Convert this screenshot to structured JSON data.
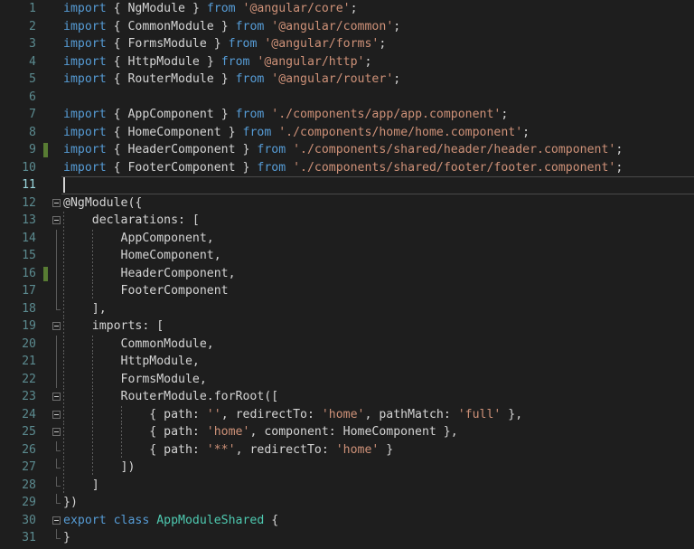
{
  "editor": {
    "language": "typescript",
    "background_color": "#1e1e1e",
    "gutter_number_color": "#5b8a8f",
    "active_gutter_number_color": "#9ad6dd",
    "change_marker_color": "#587c33",
    "colors": {
      "keyword": "#569cd6",
      "string": "#ce9178",
      "class_name": "#4ec9b0",
      "plain": "#d4d4d4"
    },
    "active_line_number": "11",
    "cursor_line": "11",
    "cursor_column": "1"
  },
  "lines": [
    {
      "n": "1",
      "changed": false,
      "fold": "none",
      "indent": 0,
      "tokens": [
        {
          "t": "import ",
          "c": "kw"
        },
        {
          "t": "{ ",
          "c": "pln"
        },
        {
          "t": "NgModule",
          "c": "pln"
        },
        {
          "t": " } ",
          "c": "pln"
        },
        {
          "t": "from ",
          "c": "kw"
        },
        {
          "t": "'@angular/core'",
          "c": "str"
        },
        {
          "t": ";",
          "c": "pln"
        }
      ]
    },
    {
      "n": "2",
      "changed": false,
      "fold": "none",
      "indent": 0,
      "tokens": [
        {
          "t": "import ",
          "c": "kw"
        },
        {
          "t": "{ ",
          "c": "pln"
        },
        {
          "t": "CommonModule",
          "c": "pln"
        },
        {
          "t": " } ",
          "c": "pln"
        },
        {
          "t": "from ",
          "c": "kw"
        },
        {
          "t": "'@angular/common'",
          "c": "str"
        },
        {
          "t": ";",
          "c": "pln"
        }
      ]
    },
    {
      "n": "3",
      "changed": false,
      "fold": "none",
      "indent": 0,
      "tokens": [
        {
          "t": "import ",
          "c": "kw"
        },
        {
          "t": "{ ",
          "c": "pln"
        },
        {
          "t": "FormsModule",
          "c": "pln"
        },
        {
          "t": " } ",
          "c": "pln"
        },
        {
          "t": "from ",
          "c": "kw"
        },
        {
          "t": "'@angular/forms'",
          "c": "str"
        },
        {
          "t": ";",
          "c": "pln"
        }
      ]
    },
    {
      "n": "4",
      "changed": false,
      "fold": "none",
      "indent": 0,
      "tokens": [
        {
          "t": "import ",
          "c": "kw"
        },
        {
          "t": "{ ",
          "c": "pln"
        },
        {
          "t": "HttpModule",
          "c": "pln"
        },
        {
          "t": " } ",
          "c": "pln"
        },
        {
          "t": "from ",
          "c": "kw"
        },
        {
          "t": "'@angular/http'",
          "c": "str"
        },
        {
          "t": ";",
          "c": "pln"
        }
      ]
    },
    {
      "n": "5",
      "changed": false,
      "fold": "none",
      "indent": 0,
      "tokens": [
        {
          "t": "import ",
          "c": "kw"
        },
        {
          "t": "{ ",
          "c": "pln"
        },
        {
          "t": "RouterModule",
          "c": "pln"
        },
        {
          "t": " } ",
          "c": "pln"
        },
        {
          "t": "from ",
          "c": "kw"
        },
        {
          "t": "'@angular/router'",
          "c": "str"
        },
        {
          "t": ";",
          "c": "pln"
        }
      ]
    },
    {
      "n": "6",
      "changed": false,
      "fold": "none",
      "indent": 0,
      "tokens": []
    },
    {
      "n": "7",
      "changed": false,
      "fold": "none",
      "indent": 0,
      "tokens": [
        {
          "t": "import ",
          "c": "kw"
        },
        {
          "t": "{ ",
          "c": "pln"
        },
        {
          "t": "AppComponent",
          "c": "pln"
        },
        {
          "t": " } ",
          "c": "pln"
        },
        {
          "t": "from ",
          "c": "kw"
        },
        {
          "t": "'./components/app/app.component'",
          "c": "str"
        },
        {
          "t": ";",
          "c": "pln"
        }
      ]
    },
    {
      "n": "8",
      "changed": false,
      "fold": "none",
      "indent": 0,
      "tokens": [
        {
          "t": "import ",
          "c": "kw"
        },
        {
          "t": "{ ",
          "c": "pln"
        },
        {
          "t": "HomeComponent",
          "c": "pln"
        },
        {
          "t": " } ",
          "c": "pln"
        },
        {
          "t": "from ",
          "c": "kw"
        },
        {
          "t": "'./components/home/home.component'",
          "c": "str"
        },
        {
          "t": ";",
          "c": "pln"
        }
      ]
    },
    {
      "n": "9",
      "changed": true,
      "fold": "none",
      "indent": 0,
      "tokens": [
        {
          "t": "import ",
          "c": "kw"
        },
        {
          "t": "{ ",
          "c": "pln"
        },
        {
          "t": "HeaderComponent",
          "c": "pln"
        },
        {
          "t": " } ",
          "c": "pln"
        },
        {
          "t": "from ",
          "c": "kw"
        },
        {
          "t": "'./components/shared/header/header.component'",
          "c": "str"
        },
        {
          "t": ";",
          "c": "pln"
        }
      ]
    },
    {
      "n": "10",
      "changed": false,
      "fold": "none",
      "indent": 0,
      "tokens": [
        {
          "t": "import ",
          "c": "kw"
        },
        {
          "t": "{ ",
          "c": "pln"
        },
        {
          "t": "FooterComponent",
          "c": "pln"
        },
        {
          "t": " } ",
          "c": "pln"
        },
        {
          "t": "from ",
          "c": "kw"
        },
        {
          "t": "'./components/shared/footer/footer.component'",
          "c": "str"
        },
        {
          "t": ";",
          "c": "pln"
        }
      ]
    },
    {
      "n": "11",
      "changed": false,
      "fold": "none",
      "indent": 0,
      "active": true,
      "tokens": []
    },
    {
      "n": "12",
      "changed": false,
      "fold": "open",
      "indent": 0,
      "tokens": [
        {
          "t": "@NgModule({",
          "c": "pln"
        }
      ]
    },
    {
      "n": "13",
      "changed": false,
      "fold": "open",
      "foldline": true,
      "indent": 1,
      "tokens": [
        {
          "t": "    declarations: [",
          "c": "pln"
        }
      ]
    },
    {
      "n": "14",
      "changed": false,
      "fold": "none",
      "foldline": true,
      "indent": 2,
      "tokens": [
        {
          "t": "        AppComponent,",
          "c": "pln"
        }
      ]
    },
    {
      "n": "15",
      "changed": false,
      "fold": "none",
      "foldline": true,
      "indent": 2,
      "tokens": [
        {
          "t": "        HomeComponent,",
          "c": "pln"
        }
      ]
    },
    {
      "n": "16",
      "changed": true,
      "fold": "none",
      "foldline": true,
      "indent": 2,
      "tokens": [
        {
          "t": "        HeaderComponent,",
          "c": "pln"
        }
      ]
    },
    {
      "n": "17",
      "changed": false,
      "fold": "none",
      "foldline": true,
      "indent": 2,
      "tokens": [
        {
          "t": "        FooterComponent",
          "c": "pln"
        }
      ]
    },
    {
      "n": "18",
      "changed": false,
      "fold": "endcap",
      "foldline": true,
      "indent": 1,
      "tokens": [
        {
          "t": "    ],",
          "c": "pln"
        }
      ]
    },
    {
      "n": "19",
      "changed": false,
      "fold": "open",
      "foldline": true,
      "indent": 1,
      "tokens": [
        {
          "t": "    imports: [",
          "c": "pln"
        }
      ]
    },
    {
      "n": "20",
      "changed": false,
      "fold": "none",
      "foldline": true,
      "indent": 2,
      "tokens": [
        {
          "t": "        CommonModule,",
          "c": "pln"
        }
      ]
    },
    {
      "n": "21",
      "changed": false,
      "fold": "none",
      "foldline": true,
      "indent": 2,
      "tokens": [
        {
          "t": "        HttpModule,",
          "c": "pln"
        }
      ]
    },
    {
      "n": "22",
      "changed": false,
      "fold": "none",
      "foldline": true,
      "indent": 2,
      "tokens": [
        {
          "t": "        FormsModule,",
          "c": "pln"
        }
      ]
    },
    {
      "n": "23",
      "changed": false,
      "fold": "open",
      "foldline": true,
      "indent": 2,
      "tokens": [
        {
          "t": "        RouterModule.forRoot([",
          "c": "pln"
        }
      ]
    },
    {
      "n": "24",
      "changed": false,
      "fold": "open",
      "foldline": true,
      "indent": 3,
      "tokens": [
        {
          "t": "            { path: ",
          "c": "pln"
        },
        {
          "t": "''",
          "c": "str"
        },
        {
          "t": ", redirectTo: ",
          "c": "pln"
        },
        {
          "t": "'home'",
          "c": "str"
        },
        {
          "t": ", pathMatch: ",
          "c": "pln"
        },
        {
          "t": "'full'",
          "c": "str"
        },
        {
          "t": " },",
          "c": "pln"
        }
      ]
    },
    {
      "n": "25",
      "changed": false,
      "fold": "open",
      "foldline": true,
      "indent": 3,
      "tokens": [
        {
          "t": "            { path: ",
          "c": "pln"
        },
        {
          "t": "'home'",
          "c": "str"
        },
        {
          "t": ", component: HomeComponent },",
          "c": "pln"
        }
      ]
    },
    {
      "n": "26",
      "changed": false,
      "fold": "endcap",
      "foldline": true,
      "indent": 3,
      "tokens": [
        {
          "t": "            { path: ",
          "c": "pln"
        },
        {
          "t": "'**'",
          "c": "str"
        },
        {
          "t": ", redirectTo: ",
          "c": "pln"
        },
        {
          "t": "'home'",
          "c": "str"
        },
        {
          "t": " }",
          "c": "pln"
        }
      ]
    },
    {
      "n": "27",
      "changed": false,
      "fold": "endcap",
      "foldline": true,
      "indent": 2,
      "tokens": [
        {
          "t": "        ])",
          "c": "pln"
        }
      ]
    },
    {
      "n": "28",
      "changed": false,
      "fold": "endcap",
      "foldline": true,
      "indent": 1,
      "tokens": [
        {
          "t": "    ]",
          "c": "pln"
        }
      ]
    },
    {
      "n": "29",
      "changed": false,
      "fold": "endcap",
      "indent": 0,
      "tokens": [
        {
          "t": "})",
          "c": "pln"
        }
      ]
    },
    {
      "n": "30",
      "changed": false,
      "fold": "open",
      "indent": 0,
      "tokens": [
        {
          "t": "export ",
          "c": "kw"
        },
        {
          "t": "class ",
          "c": "kw"
        },
        {
          "t": "AppModuleShared",
          "c": "cls"
        },
        {
          "t": " {",
          "c": "pln"
        }
      ]
    },
    {
      "n": "31",
      "changed": false,
      "fold": "endcap",
      "indent": 0,
      "tokens": [
        {
          "t": "}",
          "c": "pln"
        }
      ]
    }
  ]
}
